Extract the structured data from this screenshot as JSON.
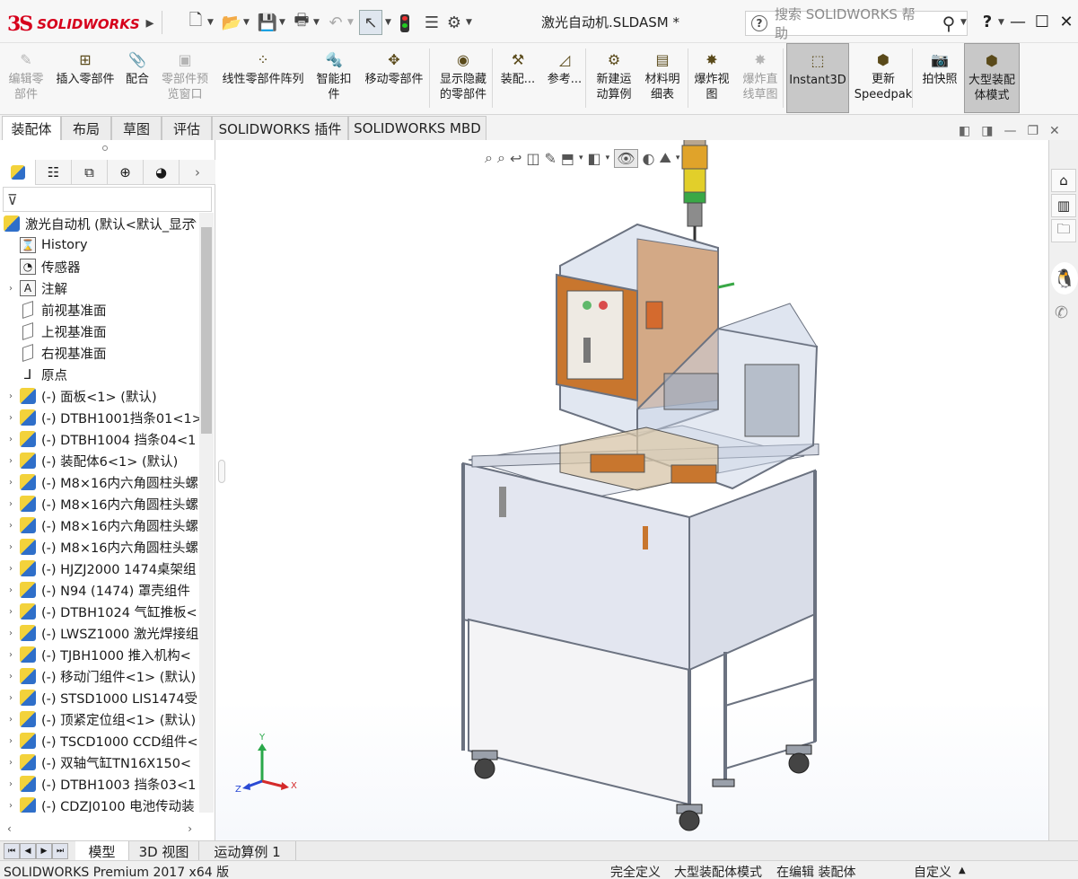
{
  "app": {
    "name": "SOLIDWORKS",
    "logo_mark": "3S"
  },
  "titlebar": {
    "doc_title": "激光自动机.SLDASM *",
    "search_placeholder": "搜索 SOLIDWORKS 帮助",
    "help": "?"
  },
  "ribbon": [
    {
      "label": "编辑零\n部件",
      "disabled": true,
      "icon": "edit-component-icon"
    },
    {
      "label": "插入零部件",
      "disabled": false,
      "icon": "insert-component-icon"
    },
    {
      "label": "配合",
      "disabled": false,
      "icon": "mate-icon"
    },
    {
      "label": "零部件预\n览窗口",
      "disabled": true,
      "icon": "component-preview-icon"
    },
    {
      "label": "线性零部件阵列",
      "disabled": false,
      "icon": "linear-pattern-icon"
    },
    {
      "label": "智能扣\n件",
      "disabled": false,
      "icon": "smart-fasteners-icon"
    },
    {
      "label": "移动零部件",
      "disabled": false,
      "icon": "move-component-icon"
    },
    {
      "label": "显示隐藏\n的零部件",
      "disabled": false,
      "icon": "show-hidden-icon"
    },
    {
      "label": "装配...",
      "disabled": false,
      "icon": "assembly-features-icon"
    },
    {
      "label": "参考...",
      "disabled": false,
      "icon": "reference-geometry-icon"
    },
    {
      "label": "新建运\n动算例",
      "disabled": false,
      "icon": "new-motion-study-icon"
    },
    {
      "label": "材料明\n细表",
      "disabled": false,
      "icon": "bom-icon"
    },
    {
      "label": "爆炸视\n图",
      "disabled": false,
      "icon": "exploded-view-icon"
    },
    {
      "label": "爆炸直\n线草图",
      "disabled": true,
      "icon": "explode-line-icon"
    },
    {
      "label": "Instant3D",
      "disabled": false,
      "active": true,
      "icon": "instant3d-icon"
    },
    {
      "label": "更新\nSpeedpak",
      "disabled": false,
      "icon": "speedpak-icon"
    },
    {
      "label": "拍快照",
      "disabled": false,
      "icon": "snapshot-icon"
    },
    {
      "label": "大型装配\n体模式",
      "disabled": false,
      "active": true,
      "icon": "large-assembly-icon"
    }
  ],
  "cmdtabs": [
    "装配体",
    "布局",
    "草图",
    "评估",
    "SOLIDWORKS 插件",
    "SOLIDWORKS MBD"
  ],
  "tree": {
    "root": "激光自动机 (默认<默认_显示",
    "items": [
      {
        "label": "History",
        "type": "folder",
        "expand": false
      },
      {
        "label": "传感器",
        "type": "folder",
        "expand": false
      },
      {
        "label": "注解",
        "type": "folder",
        "expand": true
      },
      {
        "label": "前视基准面",
        "type": "plane",
        "expand": false
      },
      {
        "label": "上视基准面",
        "type": "plane",
        "expand": false
      },
      {
        "label": "右视基准面",
        "type": "plane",
        "expand": false
      },
      {
        "label": "原点",
        "type": "origin",
        "expand": false
      },
      {
        "label": "(-) 面板<1> (默认)",
        "type": "part",
        "expand": true
      },
      {
        "label": "(-) DTBH1001挡条01<1>",
        "type": "part",
        "expand": true
      },
      {
        "label": "(-) DTBH1004 挡条04<1",
        "type": "part",
        "expand": true
      },
      {
        "label": "(-) 装配体6<1> (默认)",
        "type": "part",
        "expand": true
      },
      {
        "label": "(-) M8×16内六角圆柱头螺",
        "type": "part",
        "expand": true
      },
      {
        "label": "(-) M8×16内六角圆柱头螺",
        "type": "part",
        "expand": true
      },
      {
        "label": "(-) M8×16内六角圆柱头螺",
        "type": "part",
        "expand": true
      },
      {
        "label": "(-) M8×16内六角圆柱头螺",
        "type": "part",
        "expand": true
      },
      {
        "label": "(-) HJZJ2000 1474桌架组",
        "type": "part",
        "expand": true
      },
      {
        "label": "(-) N94 (1474) 罩壳组件",
        "type": "part",
        "expand": true
      },
      {
        "label": "(-) DTBH1024 气缸推板<",
        "type": "part",
        "expand": true
      },
      {
        "label": "(-) LWSZ1000 激光焊接组",
        "type": "part",
        "expand": true
      },
      {
        "label": "(-) TJBH1000 推入机构<",
        "type": "part",
        "expand": true
      },
      {
        "label": "(-) 移动门组件<1> (默认)",
        "type": "part",
        "expand": true
      },
      {
        "label": "(-) STSD1000 LIS1474受",
        "type": "part",
        "expand": true
      },
      {
        "label": "(-) 顶紧定位组<1> (默认)",
        "type": "part",
        "expand": true
      },
      {
        "label": "(-) TSCD1000 CCD组件<",
        "type": "part",
        "expand": true
      },
      {
        "label": "(-) 双轴气缸TN16X150<",
        "type": "part",
        "expand": true
      },
      {
        "label": "(-) DTBH1003 挡条03<1",
        "type": "part",
        "expand": true
      },
      {
        "label": "(-) CDZJ0100 电池传动装",
        "type": "part",
        "expand": true
      }
    ]
  },
  "bottomtabs": [
    "模型",
    "3D 视图",
    "运动算例 1"
  ],
  "status": {
    "product": "SOLIDWORKS Premium 2017 x64 版",
    "def": "完全定义",
    "mode": "大型装配体模式",
    "edit": "在编辑 装配体",
    "custom": "自定义"
  },
  "triad": {
    "x": "X",
    "y": "Y",
    "z": "Z"
  },
  "colors": {
    "accent": "#d6001c",
    "frame": "#7a7f8a",
    "orange": "#c8762e",
    "glass": "#c9d3e6"
  }
}
